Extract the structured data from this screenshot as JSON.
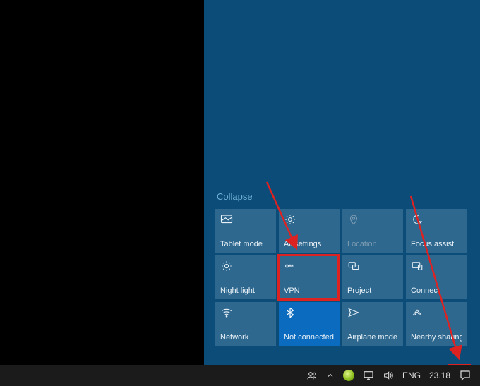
{
  "action_center": {
    "collapse_label": "Collapse",
    "tiles": [
      {
        "id": "tablet-mode",
        "label": "Tablet mode",
        "icon": "tablet-icon",
        "state": "normal"
      },
      {
        "id": "all-settings",
        "label": "All settings",
        "icon": "gear-icon",
        "state": "normal"
      },
      {
        "id": "location",
        "label": "Location",
        "icon": "location-icon",
        "state": "disabled"
      },
      {
        "id": "focus-assist",
        "label": "Focus assist",
        "icon": "moon-icon",
        "state": "normal"
      },
      {
        "id": "night-light",
        "label": "Night light",
        "icon": "sun-icon",
        "state": "normal"
      },
      {
        "id": "vpn",
        "label": "VPN",
        "icon": "vpn-icon",
        "state": "normal"
      },
      {
        "id": "project",
        "label": "Project",
        "icon": "project-icon",
        "state": "normal"
      },
      {
        "id": "connect",
        "label": "Connect",
        "icon": "connect-icon",
        "state": "normal"
      },
      {
        "id": "network",
        "label": "Network",
        "icon": "wifi-icon",
        "state": "normal"
      },
      {
        "id": "bluetooth",
        "label": "Not connected",
        "icon": "bluetooth-icon",
        "state": "active"
      },
      {
        "id": "airplane-mode",
        "label": "Airplane mode",
        "icon": "airplane-icon",
        "state": "normal"
      },
      {
        "id": "nearby-sharing",
        "label": "Nearby sharing",
        "icon": "nearby-share-icon",
        "state": "normal"
      }
    ]
  },
  "taskbar": {
    "language": "ENG",
    "clock": "23.18",
    "tray_icons": [
      "people-icon",
      "chevron-up-icon",
      "status-green-icon",
      "monitor-icon",
      "volume-icon"
    ]
  },
  "annotations": {
    "highlighted_tile": "vpn",
    "highlighted_tray": "action-center-button"
  },
  "colors": {
    "desktop_blue": "#0b4c78",
    "tile_bg": "#2f688f",
    "tile_active": "#0b6bbf",
    "highlight_red": "#d22"
  }
}
